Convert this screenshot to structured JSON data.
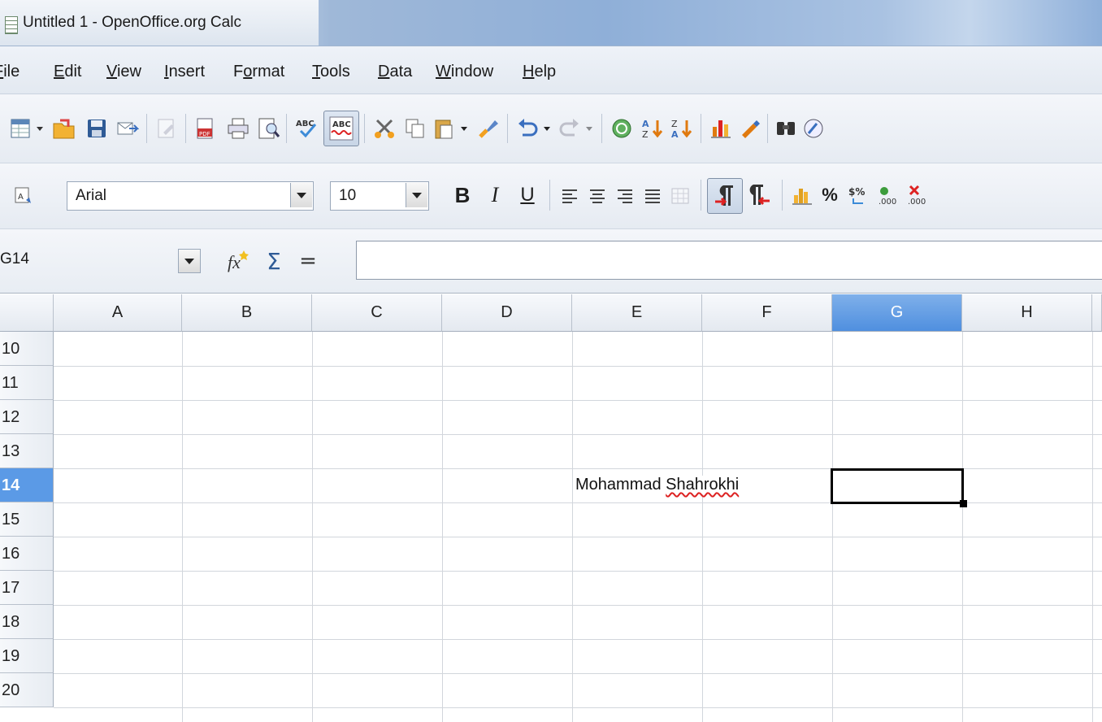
{
  "window": {
    "title": "Untitled 1 - OpenOffice.org Calc"
  },
  "menu": [
    {
      "pre": "",
      "u": "F",
      "post": "ile",
      "label": "File"
    },
    {
      "pre": "",
      "u": "E",
      "post": "dit",
      "label": "Edit"
    },
    {
      "pre": "",
      "u": "V",
      "post": "iew",
      "label": "View"
    },
    {
      "pre": "",
      "u": "I",
      "post": "nsert",
      "label": "Insert"
    },
    {
      "pre": "F",
      "u": "o",
      "post": "rmat",
      "label": "Format"
    },
    {
      "pre": "",
      "u": "T",
      "post": "ools",
      "label": "Tools"
    },
    {
      "pre": "",
      "u": "D",
      "post": "ata",
      "label": "Data"
    },
    {
      "pre": "",
      "u": "W",
      "post": "indow",
      "label": "Window"
    },
    {
      "pre": "",
      "u": "H",
      "post": "elp",
      "label": "Help"
    }
  ],
  "format_toolbar": {
    "font_name": "Arial",
    "font_size": "10",
    "bold": "B",
    "italic": "I",
    "underline": "U",
    "percent": "%"
  },
  "formula_bar": {
    "name_box": "G14",
    "sum_symbol": "Σ",
    "equals_symbol": "=",
    "formula": ""
  },
  "sheet": {
    "columns": [
      "A",
      "B",
      "C",
      "D",
      "E",
      "F",
      "G",
      "H"
    ],
    "selected_column": "G",
    "rows": [
      "10",
      "11",
      "12",
      "13",
      "14",
      "15",
      "16",
      "17",
      "18",
      "19",
      "20"
    ],
    "selected_row": "14",
    "active_cell": "G14",
    "cells": {
      "E14": {
        "first": "Mohammad",
        "second": "Shahrokhi"
      }
    }
  },
  "colors": {
    "selection_header": "#5b9ae6",
    "spellcheck_underline": "#dd2222"
  },
  "icons": [
    "new-document-icon",
    "open-folder-icon",
    "save-icon",
    "email-icon",
    "edit-file-icon",
    "export-pdf-icon",
    "print-icon",
    "page-preview-icon",
    "spellcheck-icon",
    "autospellcheck-icon",
    "cut-icon",
    "copy-icon",
    "paste-icon",
    "format-paintbrush-icon",
    "undo-icon",
    "redo-icon",
    "hyperlink-icon",
    "sort-ascending-icon",
    "sort-descending-icon",
    "chart-icon",
    "draw-functions-icon",
    "find-icon",
    "navigator-icon",
    "styles-icon",
    "align-left-icon",
    "align-center-icon",
    "align-right-icon",
    "justify-icon",
    "merge-cells-icon",
    "ltr-icon",
    "rtl-icon",
    "currency-icon",
    "percent-icon",
    "add-decimal-icon",
    "delete-decimal-icon",
    "function-wizard-icon"
  ]
}
